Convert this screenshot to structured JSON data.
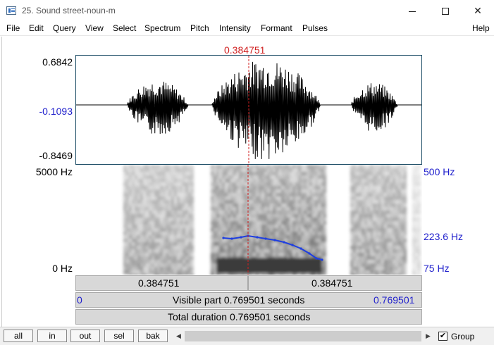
{
  "window": {
    "title": "25. Sound street-noun-m",
    "minimize_icon": "minimize-icon",
    "maximize_icon": "maximize-icon",
    "close_icon": "close-icon"
  },
  "menu": {
    "items": [
      "File",
      "Edit",
      "Query",
      "View",
      "Select",
      "Spectrum",
      "Pitch",
      "Intensity",
      "Formant",
      "Pulses"
    ],
    "help": "Help"
  },
  "cursor": {
    "time_label": "0.384751",
    "color": "#d02020"
  },
  "waveform": {
    "max": "0.6842",
    "value_at_cursor": "-0.1093",
    "min": "-0.8469"
  },
  "spectrogram": {
    "freq_max": "5000 Hz",
    "freq_min": "0 Hz"
  },
  "pitch": {
    "max": "500 Hz",
    "value_at_cursor": "223.6 Hz",
    "min": "75 Hz",
    "color": "#1f3fe0"
  },
  "selection": {
    "left_label": "0.384751",
    "right_label": "0.384751"
  },
  "visible": {
    "start": "0",
    "label": "Visible part 0.769501 seconds",
    "end": "0.769501"
  },
  "total": {
    "label": "Total duration 0.769501 seconds"
  },
  "toolbar": {
    "buttons": [
      "all",
      "in",
      "out",
      "sel",
      "bak"
    ],
    "group_label": "Group",
    "group_checked": true
  }
}
